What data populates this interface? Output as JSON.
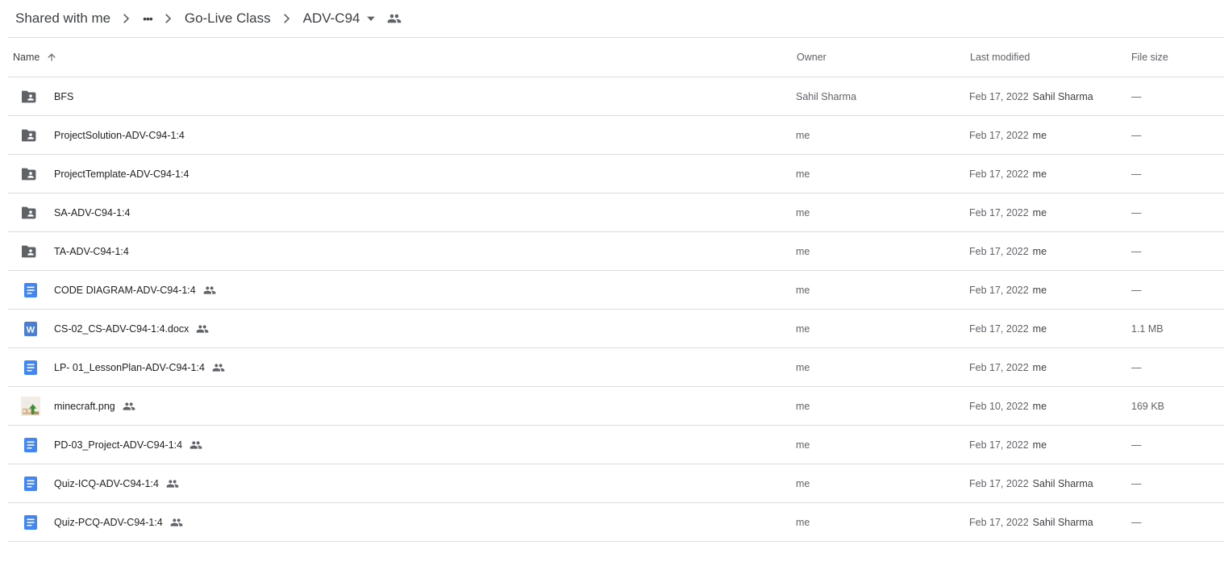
{
  "breadcrumb": {
    "root": "Shared with me",
    "more": "•••",
    "parent": "Go-Live Class",
    "current": "ADV-C94"
  },
  "columns": {
    "name": "Name",
    "owner": "Owner",
    "modified": "Last modified",
    "size": "File size"
  },
  "rows": [
    {
      "type": "shared-folder",
      "name": "BFS",
      "shared": false,
      "owner": "Sahil Sharma",
      "date": "Feb 17, 2022",
      "modified_by": "Sahil Sharma",
      "size": "—"
    },
    {
      "type": "shared-folder",
      "name": "ProjectSolution-ADV-C94-1:4",
      "shared": false,
      "owner": "me",
      "date": "Feb 17, 2022",
      "modified_by": "me",
      "size": "—"
    },
    {
      "type": "shared-folder",
      "name": "ProjectTemplate-ADV-C94-1:4",
      "shared": false,
      "owner": "me",
      "date": "Feb 17, 2022",
      "modified_by": "me",
      "size": "—"
    },
    {
      "type": "shared-folder",
      "name": "SA-ADV-C94-1:4",
      "shared": false,
      "owner": "me",
      "date": "Feb 17, 2022",
      "modified_by": "me",
      "size": "—"
    },
    {
      "type": "shared-folder",
      "name": "TA-ADV-C94-1:4",
      "shared": false,
      "owner": "me",
      "date": "Feb 17, 2022",
      "modified_by": "me",
      "size": "—"
    },
    {
      "type": "google-doc",
      "name": "CODE DIAGRAM-ADV-C94-1:4",
      "shared": true,
      "owner": "me",
      "date": "Feb 17, 2022",
      "modified_by": "me",
      "size": "—"
    },
    {
      "type": "word-doc",
      "name": "CS-02_CS-ADV-C94-1:4.docx",
      "shared": true,
      "owner": "me",
      "date": "Feb 17, 2022",
      "modified_by": "me",
      "size": "1.1 MB"
    },
    {
      "type": "google-doc",
      "name": "LP- 01_LessonPlan-ADV-C94-1:4",
      "shared": true,
      "owner": "me",
      "date": "Feb 17, 2022",
      "modified_by": "me",
      "size": "—"
    },
    {
      "type": "image",
      "name": "minecraft.png",
      "shared": true,
      "owner": "me",
      "date": "Feb 10, 2022",
      "modified_by": "me",
      "size": "169 KB"
    },
    {
      "type": "google-doc",
      "name": "PD-03_Project-ADV-C94-1:4",
      "shared": true,
      "owner": "me",
      "date": "Feb 17, 2022",
      "modified_by": "me",
      "size": "—"
    },
    {
      "type": "google-doc",
      "name": "Quiz-ICQ-ADV-C94-1:4",
      "shared": true,
      "owner": "me",
      "date": "Feb 17, 2022",
      "modified_by": "Sahil Sharma",
      "size": "—"
    },
    {
      "type": "google-doc",
      "name": "Quiz-PCQ-ADV-C94-1:4",
      "shared": true,
      "owner": "me",
      "date": "Feb 17, 2022",
      "modified_by": "Sahil Sharma",
      "size": "—"
    }
  ],
  "colors": {
    "folder_icon": "#5f6368",
    "doc_icon": "#4285f4",
    "word_icon": "#4a7fd4",
    "text_primary": "#202124",
    "text_secondary": "#5f6368",
    "divider": "#dadce0"
  }
}
